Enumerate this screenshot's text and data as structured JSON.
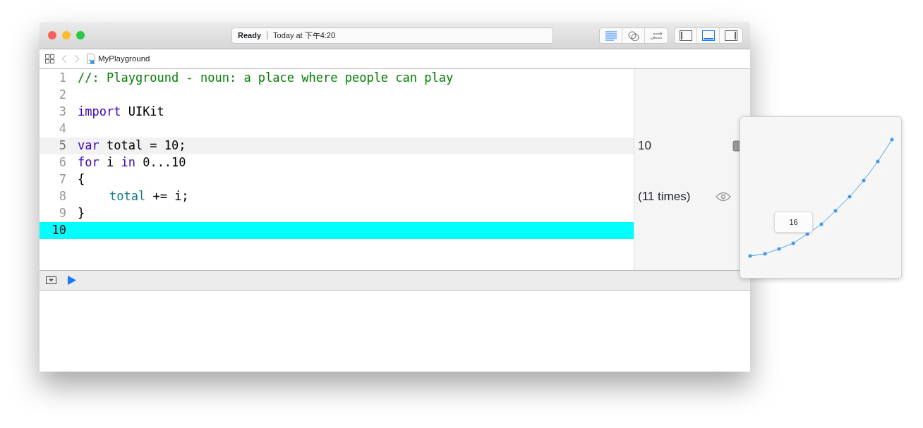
{
  "window": {
    "status": {
      "state": "Ready",
      "time": "Today at 下午4:20"
    }
  },
  "toolbar": {
    "editor_buttons": [
      {
        "kind": "standard",
        "selected": true
      },
      {
        "kind": "assistant",
        "selected": false
      },
      {
        "kind": "version",
        "selected": false
      }
    ],
    "view_buttons": [
      {
        "kind": "navigator",
        "selected": false
      },
      {
        "kind": "debug",
        "selected": true
      },
      {
        "kind": "utilities",
        "selected": false
      }
    ]
  },
  "breadcrumb": {
    "file": "MyPlayground"
  },
  "editor": {
    "lines": [
      {
        "number": "1",
        "current": false,
        "selected": false,
        "tokens": [
          {
            "kind": "comment",
            "text": "//: Playground - noun: a place where people can play"
          }
        ]
      },
      {
        "number": "2",
        "current": false,
        "selected": false
      },
      {
        "number": "3",
        "current": false,
        "selected": false,
        "tokens": [
          {
            "kind": "keyword",
            "text": "import"
          },
          {
            "kind": "plain",
            "text": " UIKit"
          }
        ]
      },
      {
        "number": "4",
        "current": false,
        "selected": false
      },
      {
        "number": "5",
        "current": true,
        "selected": false,
        "tokens": [
          {
            "kind": "keyword",
            "text": "var"
          },
          {
            "kind": "plain",
            "text": " total = 10;"
          }
        ],
        "result": {
          "kind": "value",
          "text": "10"
        }
      },
      {
        "number": "6",
        "current": false,
        "selected": false,
        "tokens": [
          {
            "kind": "keyword",
            "text": "for"
          },
          {
            "kind": "plain",
            "text": " i "
          },
          {
            "kind": "keyword",
            "text": "in"
          },
          {
            "kind": "plain",
            "text": " 0...10"
          }
        ]
      },
      {
        "number": "7",
        "current": false,
        "selected": false,
        "tokens": [
          {
            "kind": "plain",
            "text": "{"
          }
        ],
        "children": [
          {
            "number": "8",
            "current": false,
            "selected": false,
            "tokens": [
              {
                "kind": "variable",
                "text": "total"
              },
              {
                "kind": "plain",
                "text": " += i;"
              }
            ],
            "result": {
              "kind": "count",
              "text": "(11 times)"
            }
          }
        ]
      },
      {
        "number": "9",
        "current": false,
        "selected": false,
        "tokens": [
          {
            "kind": "plain",
            "text": "}"
          }
        ]
      },
      {
        "number": "10",
        "current": false,
        "selected": true
      }
    ]
  },
  "popover": {
    "tooltip": "16"
  }
}
